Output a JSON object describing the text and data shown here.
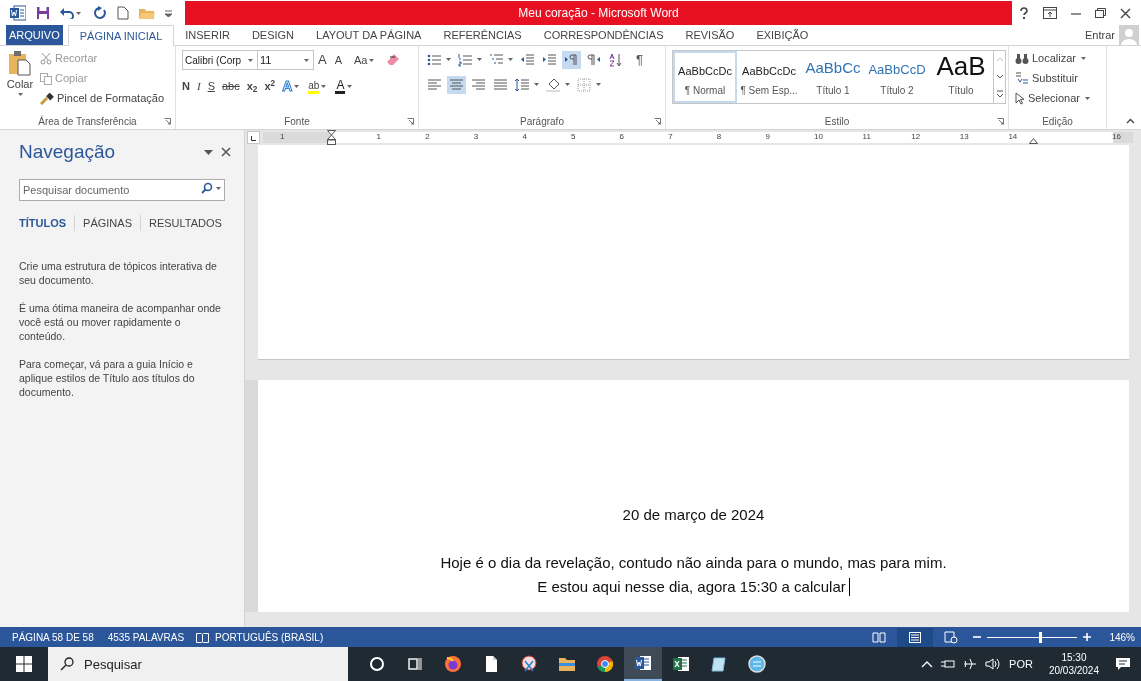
{
  "window": {
    "title": "Meu coração - Microsoft Word",
    "account": "Entrar"
  },
  "tabs": [
    {
      "label": "ARQUIVO",
      "kind": "file",
      "selected": false
    },
    {
      "label": "PÁGINA INICIAL",
      "kind": "tab",
      "selected": true
    },
    {
      "label": "INSERIR",
      "kind": "tab",
      "selected": false
    },
    {
      "label": "DESIGN",
      "kind": "tab",
      "selected": false
    },
    {
      "label": "LAYOUT DA PÁGINA",
      "kind": "tab",
      "selected": false
    },
    {
      "label": "REFERÊNCIAS",
      "kind": "tab",
      "selected": false
    },
    {
      "label": "CORRESPONDÊNCIAS",
      "kind": "tab",
      "selected": false
    },
    {
      "label": "REVISÃO",
      "kind": "tab",
      "selected": false
    },
    {
      "label": "EXIBIÇÃO",
      "kind": "tab",
      "selected": false
    }
  ],
  "clipboard": {
    "paste": "Colar",
    "cut": "Recortar",
    "copy": "Copiar",
    "format_painter": "Pincel de Formatação",
    "group_label": "Área de Transferência"
  },
  "font": {
    "name": "Calibri (Corp",
    "size": "11",
    "grow": "A",
    "shrink": "A",
    "change_case": "Aa",
    "format_buttons": [
      "N",
      "I",
      "S",
      "abc",
      "x$_{2}$",
      "x$^{2}$"
    ],
    "color_buttons": [
      {
        "label": "A",
        "kind": "effects"
      },
      {
        "label": "ab",
        "kind": "highlight"
      },
      {
        "label": "A",
        "kind": "font_color"
      }
    ],
    "group_label": "Fonte"
  },
  "paragraph": {
    "row1": [
      {
        "kind": "bullets",
        "selected": false
      },
      {
        "kind": "numbering",
        "selected": false
      },
      {
        "kind": "multilevel",
        "selected": false
      },
      {
        "kind": "outdent",
        "selected": false
      },
      {
        "kind": "indent",
        "selected": false
      },
      {
        "kind": "ltr",
        "selected": true
      },
      {
        "kind": "rtl",
        "selected": false
      },
      {
        "kind": "sort",
        "selected": false
      }
    ],
    "show_marks": "¶",
    "row2": [
      {
        "kind": "align_left",
        "selected": false
      },
      {
        "kind": "align_center",
        "selected": true
      },
      {
        "kind": "align_right",
        "selected": false
      },
      {
        "kind": "justify",
        "selected": false
      },
      {
        "kind": "line_spacing",
        "selected": false
      },
      {
        "kind": "shading",
        "selected": false
      },
      {
        "kind": "borders",
        "selected": false
      }
    ],
    "group_label": "Parágrafo"
  },
  "styles": {
    "items": [
      {
        "sample": "AaBbCcDc",
        "name": "¶ Normal",
        "kind": "normal",
        "selected": true
      },
      {
        "sample": "AaBbCcDc",
        "name": "¶ Sem Esp...",
        "kind": "normal",
        "selected": false
      },
      {
        "sample": "AaBbCc",
        "name": "Título 1",
        "kind": "heading1",
        "selected": false
      },
      {
        "sample": "AaBbCcD",
        "name": "Título 2",
        "kind": "heading2",
        "selected": false
      },
      {
        "sample": "AaB",
        "name": "Título",
        "kind": "title",
        "selected": false
      }
    ],
    "group_label": "Estilo"
  },
  "editing": {
    "find": "Localizar",
    "replace": "Substituir",
    "select": "Selecionar",
    "group_label": "Edição"
  },
  "ruler": {
    "labels": [
      "1",
      "1",
      "2",
      "3",
      "4",
      "5",
      "6",
      "7",
      "8",
      "9",
      "10",
      "11",
      "12",
      "13",
      "14",
      "16"
    ]
  },
  "navigation": {
    "title": "Navegação",
    "search": {
      "placeholder": "Pesquisar documento"
    },
    "tabs": [
      {
        "label": "TÍTULOS",
        "selected": true
      },
      {
        "label": "PÁGINAS",
        "selected": false
      },
      {
        "label": "RESULTADOS",
        "selected": false
      }
    ],
    "paragraphs": [
      "Crie uma estrutura de tópicos interativa de seu documento.",
      "É uma ótima maneira de acompanhar onde você está ou mover rapidamente o conteúdo.",
      "Para começar, vá para a guia Início e aplique estilos de Título aos títulos do documento."
    ]
  },
  "document": {
    "date_line": "20 de março de 2024",
    "lines": [
      "Hoje é o dia da revelação, contudo não ainda para o mundo, mas para mim.",
      "E estou aqui nesse dia, agora 15:30 a calcular"
    ]
  },
  "status_bar": {
    "page": "PÁGINA 58 DE 58",
    "words": "4535 PALAVRAS",
    "language": "PORTUGUÊS (BRASIL)",
    "views": [
      {
        "kind": "read",
        "selected": false
      },
      {
        "kind": "print",
        "selected": true
      },
      {
        "kind": "web",
        "selected": false
      }
    ],
    "zoom": {
      "level": 0.59,
      "reading": "146%"
    }
  },
  "taskbar": {
    "search": {
      "placeholder": "Pesquisar"
    },
    "apps": [
      {
        "kind": "cortana",
        "selected": false
      },
      {
        "kind": "taskview",
        "selected": false
      },
      {
        "kind": "firefox",
        "selected": false
      },
      {
        "kind": "file",
        "selected": false
      },
      {
        "kind": "snipping",
        "selected": false
      },
      {
        "kind": "explorer",
        "selected": false
      },
      {
        "kind": "chrome",
        "selected": false
      },
      {
        "kind": "word",
        "selected": true
      },
      {
        "kind": "excel",
        "selected": false
      },
      {
        "kind": "notepad",
        "selected": false
      },
      {
        "kind": "bs",
        "selected": false
      }
    ],
    "language": "POR",
    "time": "15:30",
    "date": "20/03/2024"
  }
}
